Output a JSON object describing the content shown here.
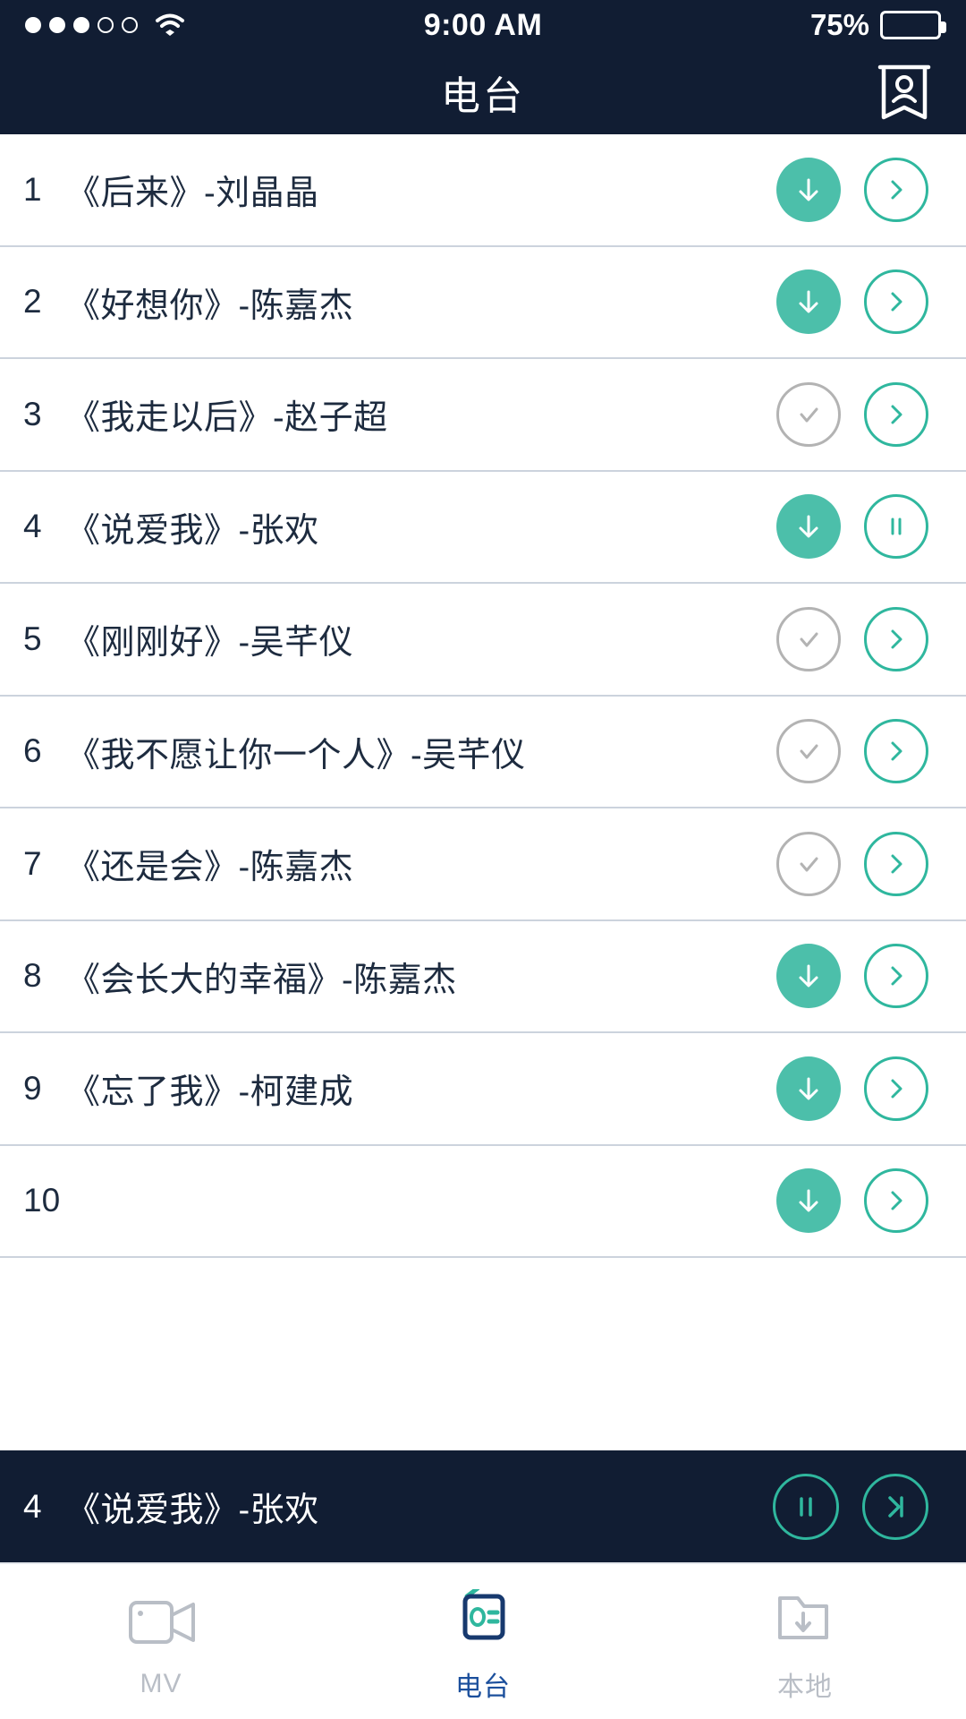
{
  "status_bar": {
    "signal_filled": 3,
    "signal_total": 5,
    "wifi_icon": "wifi-icon",
    "time": "9:00 AM",
    "battery_percent": "75%",
    "battery_level": 75
  },
  "header": {
    "title": "电台",
    "profile_icon": "profile-bookmark-icon"
  },
  "colors": {
    "navy": "#111d33",
    "teal": "#4cbfaa",
    "teal_outline": "#2fb79e",
    "gray_outline": "#b3b3b3",
    "divider": "#ccd3dd",
    "tab_active": "#1b4f9c",
    "tab_inactive": "#b9bec6"
  },
  "songs": [
    {
      "index": "1",
      "title": "《后来》-刘晶晶",
      "download_state": "downloading",
      "action": "chevron"
    },
    {
      "index": "2",
      "title": "《好想你》-陈嘉杰",
      "download_state": "downloading",
      "action": "chevron"
    },
    {
      "index": "3",
      "title": "《我走以后》-赵子超",
      "download_state": "done",
      "action": "chevron"
    },
    {
      "index": "4",
      "title": "《说爱我》-张欢",
      "download_state": "downloading",
      "action": "pause"
    },
    {
      "index": "5",
      "title": "《刚刚好》-吴芊仪",
      "download_state": "done",
      "action": "chevron"
    },
    {
      "index": "6",
      "title": "《我不愿让你一个人》-吴芊仪",
      "download_state": "done",
      "action": "chevron"
    },
    {
      "index": "7",
      "title": "《还是会》-陈嘉杰",
      "download_state": "done",
      "action": "chevron"
    },
    {
      "index": "8",
      "title": "《会长大的幸福》-陈嘉杰",
      "download_state": "downloading",
      "action": "chevron"
    },
    {
      "index": "9",
      "title": "《忘了我》-柯建成",
      "download_state": "downloading",
      "action": "chevron"
    },
    {
      "index": "10",
      "title": "",
      "download_state": "downloading",
      "action": "chevron"
    }
  ],
  "player": {
    "index": "4",
    "title": "《说爱我》-张欢",
    "pause_icon": "pause-icon",
    "next_icon": "next-track-icon"
  },
  "tabs": [
    {
      "label": "MV",
      "icon": "video-camera-icon",
      "active": false
    },
    {
      "label": "电台",
      "icon": "radio-icon",
      "active": true
    },
    {
      "label": "本地",
      "icon": "folder-download-icon",
      "active": false
    }
  ]
}
